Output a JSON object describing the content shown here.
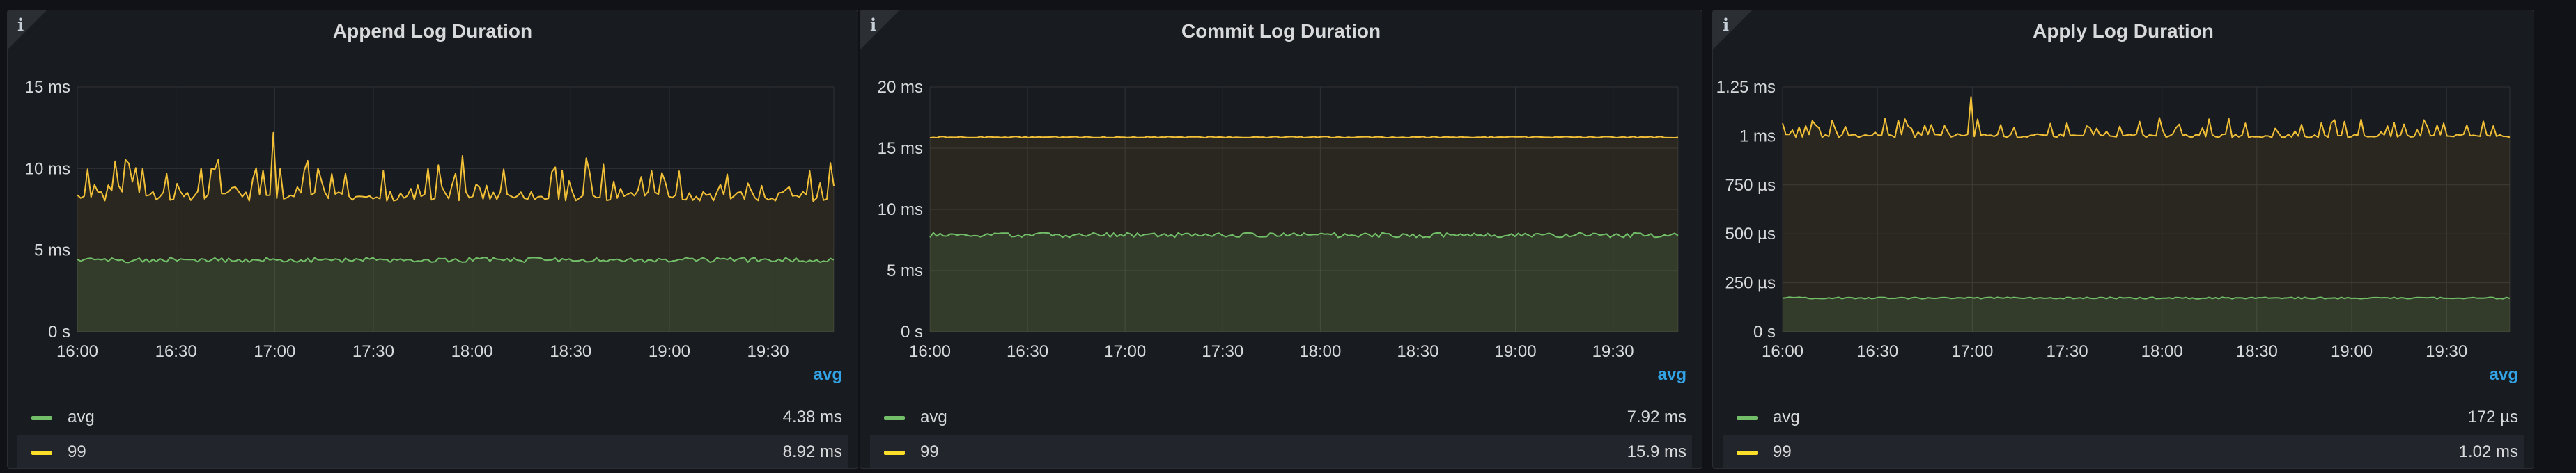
{
  "colors": {
    "avg": "#73bf69",
    "p99": "#fade2a",
    "p99_line": "#f2c037",
    "legend_head": "#33a2e5"
  },
  "panels": [
    {
      "title": "Append Log Duration",
      "info_glyph": "i",
      "legend_header": "avg",
      "legend": [
        {
          "name": "avg",
          "value": "4.38 ms"
        },
        {
          "name": "99",
          "value": "8.92 ms"
        }
      ],
      "chart_data": {
        "type": "line",
        "ylabel": "",
        "y_unit": "ms",
        "ylim": [
          0,
          15
        ],
        "y_ticks": [
          0,
          5,
          10,
          15
        ],
        "y_tick_labels": [
          "0 s",
          "5 ms",
          "10 ms",
          "15 ms"
        ],
        "x_tick_labels": [
          "16:00",
          "16:30",
          "17:00",
          "17:30",
          "18:00",
          "18:30",
          "19:00",
          "19:30"
        ],
        "x_range_minutes": [
          0,
          230
        ],
        "series": [
          {
            "name": "avg",
            "baseline": 4.4,
            "jitter": 0.15,
            "spikes": 0
          },
          {
            "name": "99",
            "baseline": 8.3,
            "jitter": 0.3,
            "spikes": 2.2,
            "max": 12.2
          }
        ]
      }
    },
    {
      "title": "Commit Log Duration",
      "info_glyph": "i",
      "legend_header": "avg",
      "legend": [
        {
          "name": "avg",
          "value": "7.92 ms"
        },
        {
          "name": "99",
          "value": "15.9 ms"
        }
      ],
      "chart_data": {
        "type": "line",
        "ylabel": "",
        "y_unit": "ms",
        "ylim": [
          0,
          20
        ],
        "y_ticks": [
          0,
          5,
          10,
          15,
          20
        ],
        "y_tick_labels": [
          "0 s",
          "5 ms",
          "10 ms",
          "15 ms",
          "20 ms"
        ],
        "x_tick_labels": [
          "16:00",
          "16:30",
          "17:00",
          "17:30",
          "18:00",
          "18:30",
          "19:00",
          "19:30"
        ],
        "x_range_minutes": [
          0,
          230
        ],
        "series": [
          {
            "name": "avg",
            "baseline": 7.9,
            "jitter": 0.2,
            "spikes": 0
          },
          {
            "name": "99",
            "baseline": 15.9,
            "jitter": 0.05,
            "spikes": 0
          }
        ]
      }
    },
    {
      "title": "Apply Log Duration",
      "info_glyph": "i",
      "legend_header": "avg",
      "legend": [
        {
          "name": "avg",
          "value": "172 µs"
        },
        {
          "name": "99",
          "value": "1.02 ms"
        }
      ],
      "chart_data": {
        "type": "line",
        "ylabel": "",
        "y_unit": "µs",
        "ylim": [
          0,
          1250
        ],
        "y_ticks": [
          0,
          250,
          500,
          750,
          1000,
          1250
        ],
        "y_tick_labels": [
          "0 s",
          "250 µs",
          "500 µs",
          "750 µs",
          "1 ms",
          "1.25 ms"
        ],
        "x_tick_labels": [
          "16:00",
          "16:30",
          "17:00",
          "17:30",
          "18:00",
          "18:30",
          "19:00",
          "19:30"
        ],
        "x_range_minutes": [
          0,
          230
        ],
        "series": [
          {
            "name": "avg",
            "baseline": 172,
            "jitter": 4,
            "spikes": 0
          },
          {
            "name": "99",
            "baseline": 1000,
            "jitter": 8,
            "spikes": 90,
            "max": 1200
          }
        ]
      }
    }
  ]
}
